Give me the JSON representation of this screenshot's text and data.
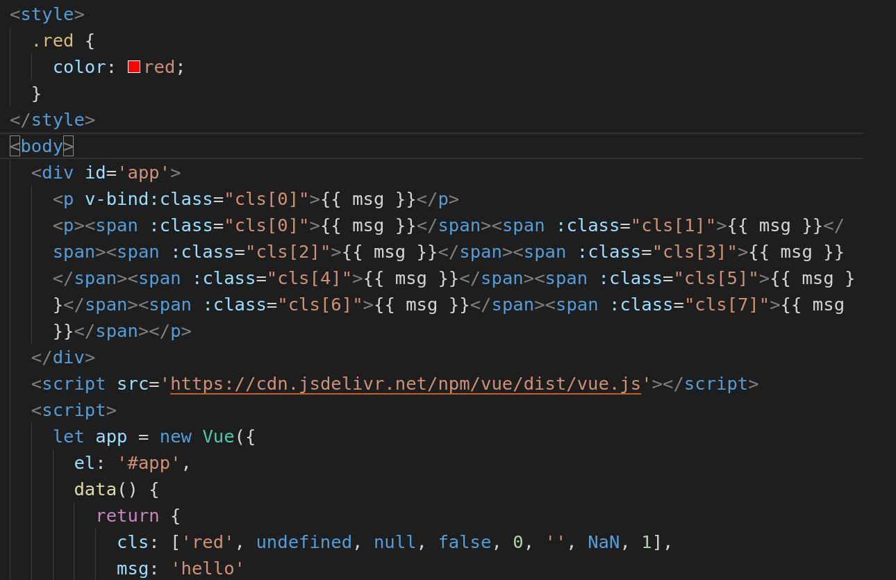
{
  "lines": [
    {
      "current": false,
      "tokens": [
        {
          "kind": "punct",
          "text": "<"
        },
        {
          "kind": "tag",
          "text": "style"
        },
        {
          "kind": "punct",
          "text": ">"
        }
      ],
      "children": [
        {
          "current": false,
          "tokens": [
            {
              "kind": "selector",
              "text": ".red"
            },
            {
              "kind": "plain",
              "text": " {"
            }
          ],
          "children": [
            {
              "current": false,
              "tokens": [
                {
                  "kind": "prop",
                  "text": "color"
                },
                {
                  "kind": "plain",
                  "text": ":"
                },
                {
                  "kind": "swatch",
                  "color": "#ff0000"
                },
                {
                  "kind": "string",
                  "text": "red"
                },
                {
                  "kind": "plain",
                  "text": ";"
                }
              ]
            }
          ]
        },
        {
          "current": false,
          "tokens": [
            {
              "kind": "plain",
              "text": "}"
            }
          ]
        }
      ]
    },
    {
      "current": false,
      "tokens": [
        {
          "kind": "punct",
          "text": "</"
        },
        {
          "kind": "tag",
          "text": "style"
        },
        {
          "kind": "punct",
          "text": ">"
        }
      ]
    },
    {
      "current": true,
      "tokens": [
        {
          "kind": "bracket",
          "text": "<"
        },
        {
          "kind": "tag",
          "text": "body"
        },
        {
          "kind": "bracket",
          "text": ">"
        }
      ],
      "children": [
        {
          "current": false,
          "tokens": [
            {
              "kind": "punct",
              "text": "<"
            },
            {
              "kind": "tag",
              "text": "div"
            },
            {
              "kind": "attr",
              "text": " id"
            },
            {
              "kind": "plain",
              "text": "="
            },
            {
              "kind": "string",
              "text": "'app'"
            },
            {
              "kind": "punct",
              "text": ">"
            }
          ],
          "children": [
            {
              "current": false,
              "tokens": [
                {
                  "kind": "punct",
                  "text": "<"
                },
                {
                  "kind": "tag",
                  "text": "p"
                },
                {
                  "kind": "attr",
                  "text": " v-bind:class"
                },
                {
                  "kind": "plain",
                  "text": "="
                },
                {
                  "kind": "string",
                  "text": "\"cls[0]\""
                },
                {
                  "kind": "punct",
                  "text": ">"
                },
                {
                  "kind": "plain",
                  "text": "{{ msg }}"
                },
                {
                  "kind": "punct",
                  "text": "</"
                },
                {
                  "kind": "tag",
                  "text": "p"
                },
                {
                  "kind": "punct",
                  "text": ">"
                }
              ]
            },
            {
              "current": false,
              "tokens": [
                {
                  "kind": "punct",
                  "text": "<"
                },
                {
                  "kind": "tag",
                  "text": "p"
                },
                {
                  "kind": "punct",
                  "text": "><"
                },
                {
                  "kind": "tag",
                  "text": "span"
                },
                {
                  "kind": "attr",
                  "text": " :class"
                },
                {
                  "kind": "plain",
                  "text": "="
                },
                {
                  "kind": "string",
                  "text": "\"cls[0]\""
                },
                {
                  "kind": "punct",
                  "text": ">"
                },
                {
                  "kind": "plain",
                  "text": "{{ msg }}"
                },
                {
                  "kind": "punct",
                  "text": "</"
                },
                {
                  "kind": "tag",
                  "text": "span"
                },
                {
                  "kind": "punct",
                  "text": "><"
                },
                {
                  "kind": "tag",
                  "text": "span"
                },
                {
                  "kind": "attr",
                  "text": " :class"
                },
                {
                  "kind": "plain",
                  "text": "="
                },
                {
                  "kind": "string",
                  "text": "\"cls[1]\""
                },
                {
                  "kind": "punct",
                  "text": ">"
                },
                {
                  "kind": "plain",
                  "text": "{{ msg }}"
                },
                {
                  "kind": "punct",
                  "text": "</"
                }
              ]
            },
            {
              "current": false,
              "tokens": [
                {
                  "kind": "tag",
                  "text": "span"
                },
                {
                  "kind": "punct",
                  "text": "><"
                },
                {
                  "kind": "tag",
                  "text": "span"
                },
                {
                  "kind": "attr",
                  "text": " :class"
                },
                {
                  "kind": "plain",
                  "text": "="
                },
                {
                  "kind": "string",
                  "text": "\"cls[2]\""
                },
                {
                  "kind": "punct",
                  "text": ">"
                },
                {
                  "kind": "plain",
                  "text": "{{ msg }}"
                },
                {
                  "kind": "punct",
                  "text": "</"
                },
                {
                  "kind": "tag",
                  "text": "span"
                },
                {
                  "kind": "punct",
                  "text": "><"
                },
                {
                  "kind": "tag",
                  "text": "span"
                },
                {
                  "kind": "attr",
                  "text": " :class"
                },
                {
                  "kind": "plain",
                  "text": "="
                },
                {
                  "kind": "string",
                  "text": "\"cls[3]\""
                },
                {
                  "kind": "punct",
                  "text": ">"
                },
                {
                  "kind": "plain",
                  "text": "{{ msg }}"
                }
              ]
            },
            {
              "current": false,
              "tokens": [
                {
                  "kind": "punct",
                  "text": "</"
                },
                {
                  "kind": "tag",
                  "text": "span"
                },
                {
                  "kind": "punct",
                  "text": "><"
                },
                {
                  "kind": "tag",
                  "text": "span"
                },
                {
                  "kind": "attr",
                  "text": " :class"
                },
                {
                  "kind": "plain",
                  "text": "="
                },
                {
                  "kind": "string",
                  "text": "\"cls[4]\""
                },
                {
                  "kind": "punct",
                  "text": ">"
                },
                {
                  "kind": "plain",
                  "text": "{{ msg }}"
                },
                {
                  "kind": "punct",
                  "text": "</"
                },
                {
                  "kind": "tag",
                  "text": "span"
                },
                {
                  "kind": "punct",
                  "text": "><"
                },
                {
                  "kind": "tag",
                  "text": "span"
                },
                {
                  "kind": "attr",
                  "text": " :class"
                },
                {
                  "kind": "plain",
                  "text": "="
                },
                {
                  "kind": "string",
                  "text": "\"cls[5]\""
                },
                {
                  "kind": "punct",
                  "text": ">"
                },
                {
                  "kind": "plain",
                  "text": "{{ msg }"
                }
              ]
            },
            {
              "current": false,
              "tokens": [
                {
                  "kind": "plain",
                  "text": "}"
                },
                {
                  "kind": "punct",
                  "text": "</"
                },
                {
                  "kind": "tag",
                  "text": "span"
                },
                {
                  "kind": "punct",
                  "text": "><"
                },
                {
                  "kind": "tag",
                  "text": "span"
                },
                {
                  "kind": "attr",
                  "text": " :class"
                },
                {
                  "kind": "plain",
                  "text": "="
                },
                {
                  "kind": "string",
                  "text": "\"cls[6]\""
                },
                {
                  "kind": "punct",
                  "text": ">"
                },
                {
                  "kind": "plain",
                  "text": "{{ msg }}"
                },
                {
                  "kind": "punct",
                  "text": "</"
                },
                {
                  "kind": "tag",
                  "text": "span"
                },
                {
                  "kind": "punct",
                  "text": "><"
                },
                {
                  "kind": "tag",
                  "text": "span"
                },
                {
                  "kind": "attr",
                  "text": " :class"
                },
                {
                  "kind": "plain",
                  "text": "="
                },
                {
                  "kind": "string",
                  "text": "\"cls[7]\""
                },
                {
                  "kind": "punct",
                  "text": ">"
                },
                {
                  "kind": "plain",
                  "text": "{{ msg"
                }
              ]
            },
            {
              "current": false,
              "tokens": [
                {
                  "kind": "plain",
                  "text": "}}"
                },
                {
                  "kind": "punct",
                  "text": "</"
                },
                {
                  "kind": "tag",
                  "text": "span"
                },
                {
                  "kind": "punct",
                  "text": "></"
                },
                {
                  "kind": "tag",
                  "text": "p"
                },
                {
                  "kind": "punct",
                  "text": ">"
                }
              ]
            }
          ]
        },
        {
          "current": false,
          "tokens": [
            {
              "kind": "punct",
              "text": "</"
            },
            {
              "kind": "tag",
              "text": "div"
            },
            {
              "kind": "punct",
              "text": ">"
            }
          ]
        },
        {
          "current": false,
          "tokens": [
            {
              "kind": "punct",
              "text": "<"
            },
            {
              "kind": "tag",
              "text": "script"
            },
            {
              "kind": "attr",
              "text": " src"
            },
            {
              "kind": "plain",
              "text": "="
            },
            {
              "kind": "string",
              "text": "'"
            },
            {
              "kind": "url",
              "text": "https://cdn.jsdelivr.net/npm/vue/dist/vue.js"
            },
            {
              "kind": "string",
              "text": "'"
            },
            {
              "kind": "punct",
              "text": "></"
            },
            {
              "kind": "tag",
              "text": "script"
            },
            {
              "kind": "punct",
              "text": ">"
            }
          ]
        },
        {
          "current": false,
          "tokens": [
            {
              "kind": "punct",
              "text": "<"
            },
            {
              "kind": "tag",
              "text": "script"
            },
            {
              "kind": "punct",
              "text": ">"
            }
          ],
          "children": [
            {
              "current": false,
              "tokens": [
                {
                  "kind": "keyword",
                  "text": "let"
                },
                {
                  "kind": "var",
                  "text": " app"
                },
                {
                  "kind": "plain",
                  "text": " ="
                },
                {
                  "kind": "keyword",
                  "text": " new"
                },
                {
                  "kind": "class",
                  "text": " Vue"
                },
                {
                  "kind": "plain",
                  "text": "({"
                }
              ],
              "children": [
                {
                  "current": false,
                  "tokens": [
                    {
                      "kind": "var",
                      "text": "el"
                    },
                    {
                      "kind": "plain",
                      "text": ":"
                    },
                    {
                      "kind": "string",
                      "text": " '#app'"
                    },
                    {
                      "kind": "plain",
                      "text": ","
                    }
                  ]
                },
                {
                  "current": false,
                  "tokens": [
                    {
                      "kind": "fn",
                      "text": "data"
                    },
                    {
                      "kind": "plain",
                      "text": "() {"
                    }
                  ],
                  "children": [
                    {
                      "current": false,
                      "tokens": [
                        {
                          "kind": "control",
                          "text": "return"
                        },
                        {
                          "kind": "plain",
                          "text": " {"
                        }
                      ],
                      "children": [
                        {
                          "current": false,
                          "tokens": [
                            {
                              "kind": "var",
                              "text": "cls"
                            },
                            {
                              "kind": "plain",
                              "text": ": ["
                            },
                            {
                              "kind": "string",
                              "text": "'red'"
                            },
                            {
                              "kind": "plain",
                              "text": ","
                            },
                            {
                              "kind": "keyword",
                              "text": " undefined"
                            },
                            {
                              "kind": "plain",
                              "text": ","
                            },
                            {
                              "kind": "keyword",
                              "text": " null"
                            },
                            {
                              "kind": "plain",
                              "text": ","
                            },
                            {
                              "kind": "keyword",
                              "text": " false"
                            },
                            {
                              "kind": "plain",
                              "text": ","
                            },
                            {
                              "kind": "number",
                              "text": " 0"
                            },
                            {
                              "kind": "plain",
                              "text": ","
                            },
                            {
                              "kind": "string",
                              "text": " ''"
                            },
                            {
                              "kind": "plain",
                              "text": ","
                            },
                            {
                              "kind": "keyword",
                              "text": " NaN"
                            },
                            {
                              "kind": "plain",
                              "text": ","
                            },
                            {
                              "kind": "number",
                              "text": " 1"
                            },
                            {
                              "kind": "plain",
                              "text": "],"
                            }
                          ]
                        },
                        {
                          "current": false,
                          "tokens": [
                            {
                              "kind": "var",
                              "text": "msg"
                            },
                            {
                              "kind": "plain",
                              "text": ":"
                            },
                            {
                              "kind": "string",
                              "text": " 'hello'"
                            }
                          ]
                        }
                      ]
                    }
                  ]
                }
              ]
            }
          ]
        }
      ]
    }
  ]
}
